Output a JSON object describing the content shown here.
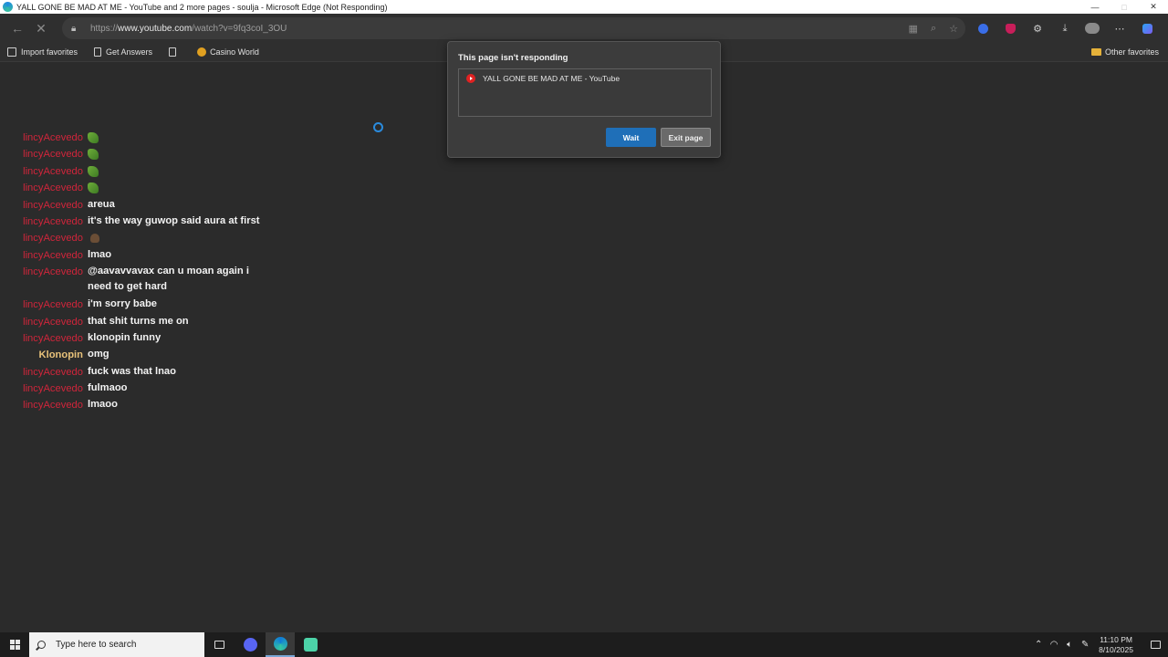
{
  "window": {
    "title": "YALL GONE BE MAD AT ME - YouTube and 2 more pages - soulja - Microsoft Edge (Not Responding)",
    "controls": {
      "minimize": "—",
      "maximize": "□",
      "close": "✕"
    }
  },
  "toolbar": {
    "back_icon": "←",
    "stop_icon": "✕",
    "url_prefix": "https://",
    "url_host": "www.youtube.com",
    "url_path": "/watch?v=9fq3coI_3OU"
  },
  "favorites": {
    "items": [
      "Import favorites",
      "Get Answers",
      "",
      "Casino World"
    ],
    "other": "Other favorites"
  },
  "chat": [
    {
      "user": "lincyAcevedo",
      "type": "emoji-green",
      "msg": ""
    },
    {
      "user": "lincyAcevedo",
      "type": "emoji-green",
      "msg": ""
    },
    {
      "user": "lincyAcevedo",
      "type": "emoji-green",
      "msg": ""
    },
    {
      "user": "lincyAcevedo",
      "type": "emoji-green",
      "msg": ""
    },
    {
      "user": "lincyAcevedo",
      "type": "text",
      "msg": "areua"
    },
    {
      "user": "lincyAcevedo",
      "type": "text",
      "msg": "it's the way guwop said aura at first"
    },
    {
      "user": "lincyAcevedo",
      "type": "emoji-brown",
      "msg": ""
    },
    {
      "user": "lincyAcevedo",
      "type": "text",
      "msg": "lmao"
    },
    {
      "user": "lincyAcevedo",
      "type": "text-tall",
      "msg": "@aavavvavax can u moan again i need to get hard"
    },
    {
      "user": "lincyAcevedo",
      "type": "text",
      "msg": "i'm sorry babe"
    },
    {
      "user": "lincyAcevedo",
      "type": "text",
      "msg": "that shit turns me on"
    },
    {
      "user": "lincyAcevedo",
      "type": "text",
      "msg": "klonopin funny"
    },
    {
      "user": "Klonopin",
      "type": "text-k",
      "msg": "omg"
    },
    {
      "user": "lincyAcevedo",
      "type": "text",
      "msg": "fuck was that lnao"
    },
    {
      "user": "lincyAcevedo",
      "type": "text",
      "msg": "fulmaoo"
    },
    {
      "user": "lincyAcevedo",
      "type": "text",
      "msg": "lmaoo"
    }
  ],
  "dialog": {
    "title": "This page isn't responding",
    "page_item": "YALL GONE BE MAD AT ME - YouTube",
    "wait_label": "Wait",
    "exit_label": "Exit page"
  },
  "taskbar": {
    "search_placeholder": "Type here to search",
    "time": "11:10 PM",
    "date": "8/10/2025"
  }
}
